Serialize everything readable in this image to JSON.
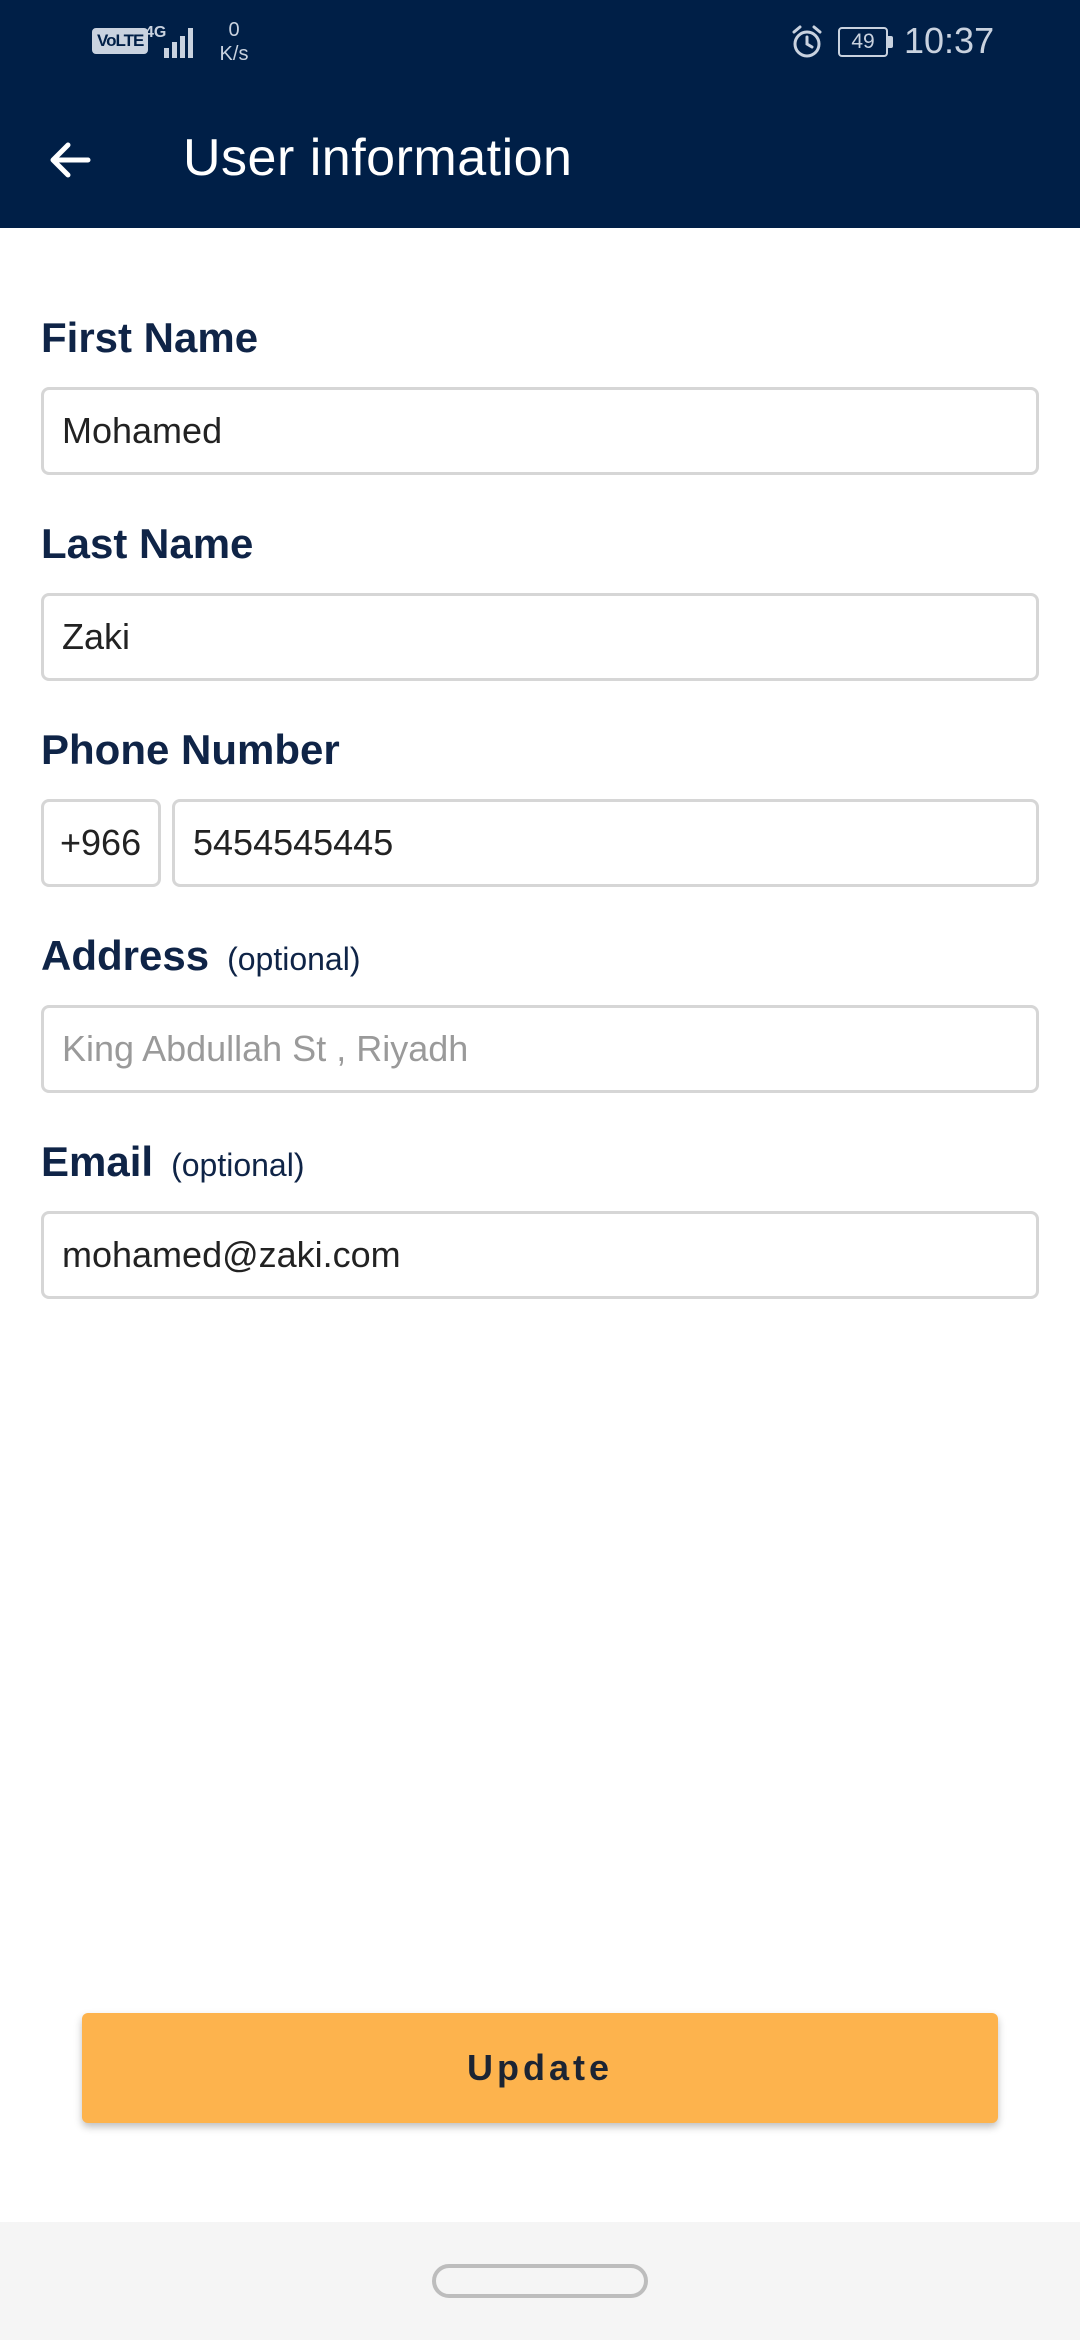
{
  "status_bar": {
    "network_badge": "VoLTE",
    "network_type": "4G",
    "speed_value": "0",
    "speed_unit": "K/s",
    "battery": "49",
    "time": "10:37"
  },
  "app_bar": {
    "title": "User information",
    "back_icon": "arrow-left-icon"
  },
  "form": {
    "first_name": {
      "label": "First Name",
      "value": "Mohamed"
    },
    "last_name": {
      "label": "Last Name",
      "value": "Zaki"
    },
    "phone": {
      "label": "Phone Number",
      "country_code": "+966",
      "value": "5454545445"
    },
    "address": {
      "label": "Address",
      "optional": "(optional)",
      "placeholder": "King Abdullah St , Riyadh",
      "value": ""
    },
    "email": {
      "label": "Email",
      "optional": "(optional)",
      "value": "mohamed@zaki.com"
    }
  },
  "actions": {
    "update_label": "Update"
  },
  "colors": {
    "header": "#001f47",
    "label": "#0f2447",
    "button": "#fdb34d"
  }
}
